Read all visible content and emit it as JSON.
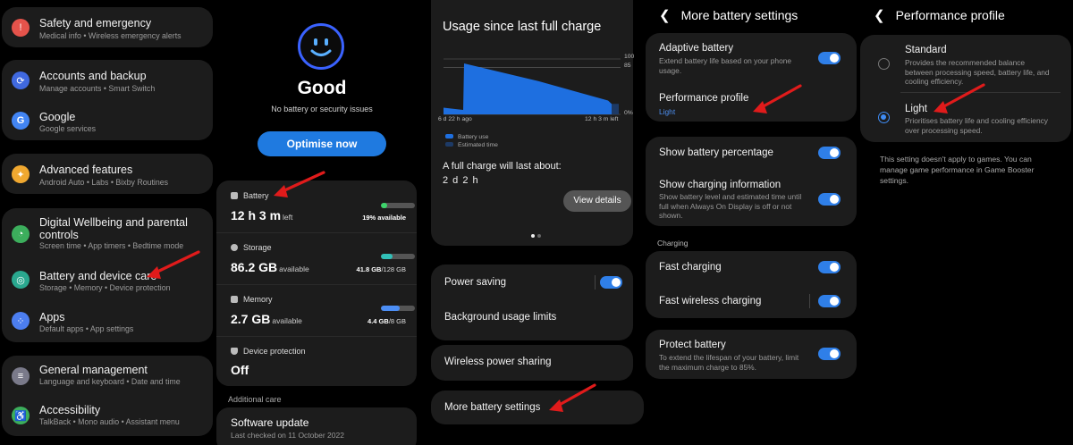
{
  "colors": {
    "accent": "#1f7ae0",
    "toggle": "#2f7fe8",
    "card": "#1c1c1c",
    "arrow": "#e01b1b"
  },
  "panel1": {
    "items": [
      {
        "title": "Safety and emergency",
        "sub": "Medical info  •  Wireless emergency alerts",
        "icon": "alert-icon",
        "color": "#e5534b"
      },
      {
        "title": "Accounts and backup",
        "sub": "Manage accounts  •  Smart Switch",
        "icon": "sync-icon",
        "color": "#4069e0"
      },
      {
        "title": "Google",
        "sub": "Google services",
        "icon": "google-icon",
        "color": "#4285f4"
      },
      {
        "title": "Advanced features",
        "sub": "Android Auto  •  Labs  •  Bixby Routines",
        "icon": "star-gear-icon",
        "color": "#f0a830"
      },
      {
        "title": "Digital Wellbeing and parental controls",
        "sub": "Screen time  •  App timers  •  Bedtime mode",
        "icon": "wellbeing-icon",
        "color": "#3cae5c"
      },
      {
        "title": "Battery and device care",
        "sub": "Storage  •  Memory  •  Device protection",
        "icon": "device-care-icon",
        "color": "#2aa88f"
      },
      {
        "title": "Apps",
        "sub": "Default apps  •  App settings",
        "icon": "apps-icon",
        "color": "#4c7ef0"
      },
      {
        "title": "General management",
        "sub": "Language and keyboard  •  Date and time",
        "icon": "sliders-icon",
        "color": "#7a7a8a"
      },
      {
        "title": "Accessibility",
        "sub": "TalkBack  •  Mono audio  •  Assistant menu",
        "icon": "accessibility-icon",
        "color": "#3cae5c"
      }
    ]
  },
  "panel2": {
    "status": "Good",
    "status_sub": "No battery or security issues",
    "optimise_label": "Optimise now",
    "battery": {
      "label": "Battery",
      "value": "12 h 3 m",
      "unit": "left",
      "bar_text": "19% available",
      "fill": 0.19,
      "color": "#3dd46b"
    },
    "storage": {
      "label": "Storage",
      "value": "86.2 GB",
      "unit": "available",
      "bar_used": "41.8 GB",
      "bar_total": "/128 GB",
      "fill": 0.33,
      "color": "#31c0b8"
    },
    "memory": {
      "label": "Memory",
      "value": "2.7 GB",
      "unit": "available",
      "bar_used": "4.4 GB",
      "bar_total": "/8 GB",
      "fill": 0.55,
      "color": "#4c8ef5"
    },
    "protection": {
      "label": "Device protection",
      "value": "Off"
    },
    "additional_care": "Additional care",
    "software_update": {
      "title": "Software update",
      "sub": "Last checked on 11 October 2022"
    }
  },
  "panel3": {
    "title": "Usage since last full charge",
    "y_ticks": [
      "100",
      "85",
      "0%"
    ],
    "x_start": "6 d 22 h ago",
    "x_end": "12 h 3 m left",
    "legend_use": "Battery use",
    "legend_est": "Estimated time",
    "full_charge_text": "A full charge will last about:",
    "full_charge_value": "2 d 2 h",
    "view_details": "View details",
    "menu": [
      "Power saving",
      "Background usage limits",
      "Wireless power sharing",
      "More battery settings"
    ]
  },
  "chart_data": {
    "type": "area",
    "title": "Usage since last full charge",
    "xlabel": "",
    "ylabel": "",
    "ylim": [
      0,
      100
    ],
    "x": [
      "6 d 22 h ago",
      "",
      "",
      "",
      "",
      "12 h 3 m left"
    ],
    "series": [
      {
        "name": "Battery use",
        "values": [
          12,
          8,
          92,
          60,
          25,
          19
        ]
      },
      {
        "name": "Estimated time",
        "values": [
          null,
          null,
          null,
          null,
          null,
          19
        ]
      }
    ]
  },
  "panel4": {
    "title": "More battery settings",
    "adaptive": {
      "title": "Adaptive battery",
      "desc": [
        "Extend battery life based on your phone",
        "usage."
      ]
    },
    "performance": {
      "title": "Performance profile",
      "value": "Light"
    },
    "show_pct": "Show battery percentage",
    "show_charging": {
      "title": "Show charging information",
      "desc": [
        "Show battery level and estimated time until",
        "full when Always On Display is off or not",
        "shown."
      ]
    },
    "charging_section": "Charging",
    "fast_charging": "Fast charging",
    "fast_wireless": "Fast wireless charging",
    "protect": {
      "title": "Protect battery",
      "desc": [
        "To extend the lifespan of your battery, limit",
        "the maximum charge to 85%."
      ]
    }
  },
  "panel5": {
    "title": "Performance profile",
    "standard": {
      "title": "Standard",
      "desc": [
        "Provides the recommended balance",
        "between processing speed, battery life, and",
        "cooling efficiency."
      ]
    },
    "light": {
      "title": "Light",
      "desc": [
        "Prioritises battery life and cooling efficiency",
        "over processing speed."
      ]
    },
    "note": [
      "This setting doesn't apply to games. You can",
      "manage game performance in Game Booster",
      "settings."
    ]
  }
}
